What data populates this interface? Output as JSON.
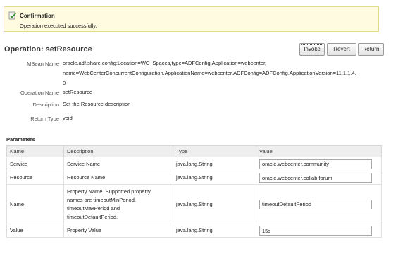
{
  "confirmation": {
    "title": "Confirmation",
    "message": "Operation executed successfully."
  },
  "operation": {
    "title": "Operation: setResource",
    "buttons": {
      "invoke": "Invoke",
      "revert": "Revert",
      "return": "Return"
    },
    "mbean_label": "MBean Name",
    "mbean_lines": [
      "oracle.adf.share.config:Location=WC_Spaces,type=ADFConfig,Application=webcenter,",
      "name=WebCenterConcurrentConfiguration,ApplicationName=webcenter,ADFConfig=ADFConfig,ApplicationVersion=11.1.1.4.",
      "0"
    ],
    "name_label": "Operation Name",
    "name_value": "setResource",
    "description_label": "Description",
    "description_value": "Set the Resource description",
    "return_label": "Return Type",
    "return_value": "void"
  },
  "parameters": {
    "title": "Parameters",
    "headers": {
      "name": "Name",
      "description": "Description",
      "type": "Type",
      "value": "Value"
    },
    "rows": [
      {
        "name": "Service",
        "description": [
          "Service Name"
        ],
        "type": "java.lang.String",
        "value": "oracle.webcenter.community"
      },
      {
        "name": "Resource",
        "description": [
          "Resource Name"
        ],
        "type": "java.lang.String",
        "value": "oracle.webcenter.collab.forum"
      },
      {
        "name": "Name",
        "description": [
          "Property Name. Supported property",
          "names are timeoutMinPeriod,",
          "timeoutMaxPeriod and",
          "timeoutDefaultPeriod."
        ],
        "type": "java.lang.String",
        "value": "timeoutDefaultPeriod"
      },
      {
        "name": "Value",
        "description": [
          "Property Value"
        ],
        "type": "java.lang.String",
        "value": "15s"
      }
    ]
  }
}
